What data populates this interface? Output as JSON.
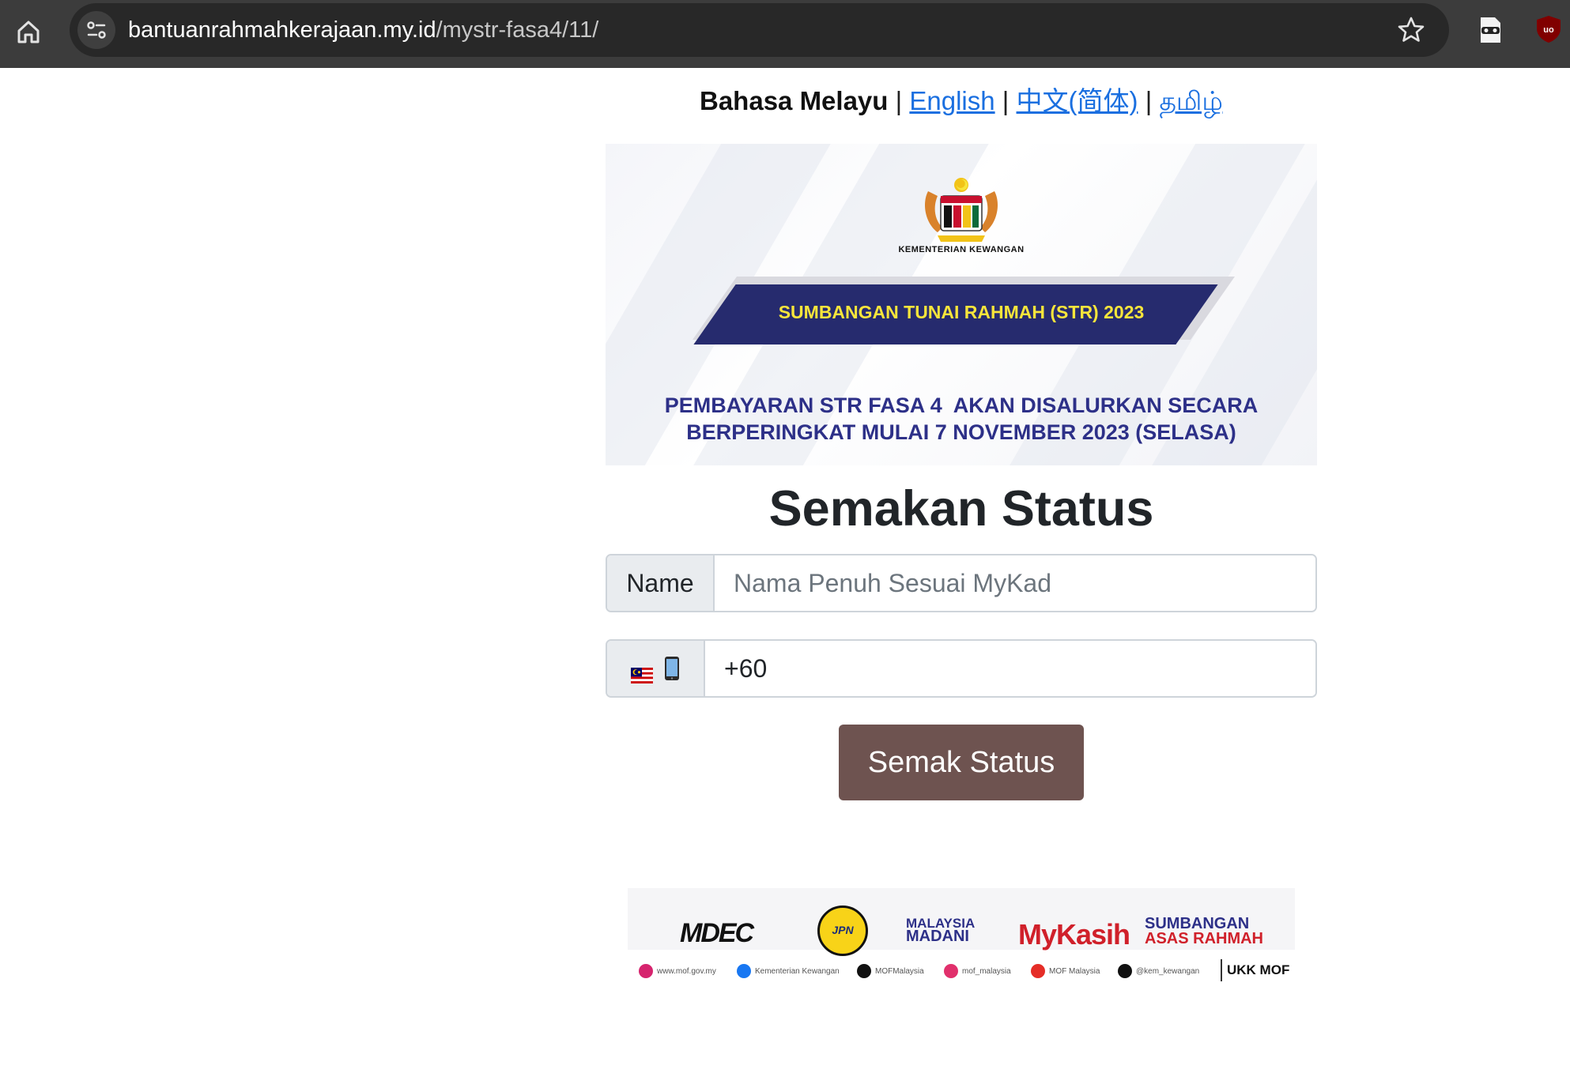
{
  "browser": {
    "url_host": "bantuanrahmahkerajaan.my.id",
    "url_path": "/mystr-fasa4/11/"
  },
  "languages": {
    "current": "Bahasa Melayu",
    "separator": "|",
    "english": "English",
    "chinese": "中文(简体)",
    "tamil": "தமிழ்"
  },
  "banner": {
    "ministry": "KEMENTERIAN KEWANGAN",
    "program": "SUMBANGAN TUNAI RAHMAH (STR) 2023",
    "notice_line1": "PEMBAYARAN STR FASA 4  AKAN DISALURKAN SECARA",
    "notice_line2": "BERPERINGKAT MULAI 7 NOVEMBER 2023 (SELASA)"
  },
  "form": {
    "title": "Semakan Status",
    "name_label": "Name",
    "name_placeholder": "Nama Penuh Sesuai MyKad",
    "phone_value": "+60",
    "submit_label": "Semak Status"
  },
  "footer": {
    "logo_mdec": "MDEC",
    "logo_jpn": "JPN",
    "logo_madani_1": "MALAYSIA",
    "logo_madani_2": "MADANI",
    "logo_mykasih": "MyKasih",
    "logo_sar_1": "SUMBANGAN",
    "logo_sar_2": "ASAS RAHMAH",
    "social_web": "www.mof.gov.my",
    "social_fb": "Kementerian Kewangan",
    "social_x": "MOFMalaysia",
    "social_ig": "mof_malaysia",
    "social_yt": "MOF Malaysia",
    "social_tiktok": "@kem_kewangan",
    "ukk": "UKK MOF"
  },
  "colors": {
    "chrome_bg": "#3c3c3c",
    "link": "#1a6fe0",
    "banner_navy": "#262b6e",
    "banner_yellow": "#f7e53b",
    "button_bg": "#6e5350"
  }
}
